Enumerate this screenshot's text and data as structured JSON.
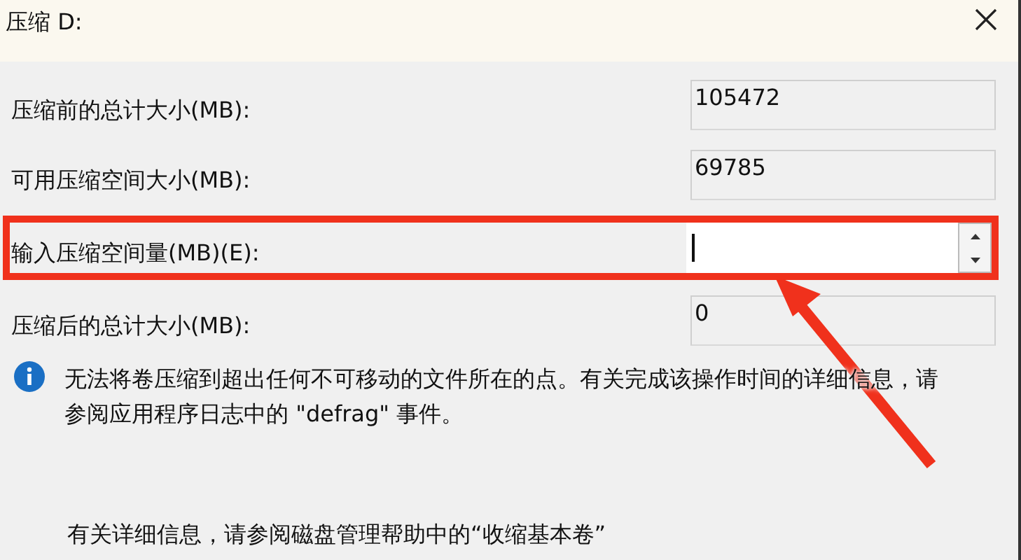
{
  "window": {
    "title": "压缩 D:"
  },
  "fields": [
    {
      "label": "压缩前的总计大小(MB):",
      "value": "105472",
      "kind": "readonly",
      "highlighted": false
    },
    {
      "label": "可用压缩空间大小(MB):",
      "value": "69785",
      "kind": "readonly",
      "highlighted": false
    },
    {
      "label": "输入压缩空间量(MB)(E):",
      "kind": "spin",
      "focused": true,
      "highlighted": true
    },
    {
      "label": "压缩后的总计大小(MB):",
      "value": "0",
      "kind": "readonly",
      "highlighted": false
    }
  ],
  "info": {
    "text": "无法将卷压缩到超出任何不可移动的文件所在的点。有关完成该操作时间的详细信息，请参阅应用程序日志中的 \"defrag\" 事件。"
  },
  "footer_note": "有关详细信息，请参阅磁盘管理帮助中的“收缩基本卷”"
}
